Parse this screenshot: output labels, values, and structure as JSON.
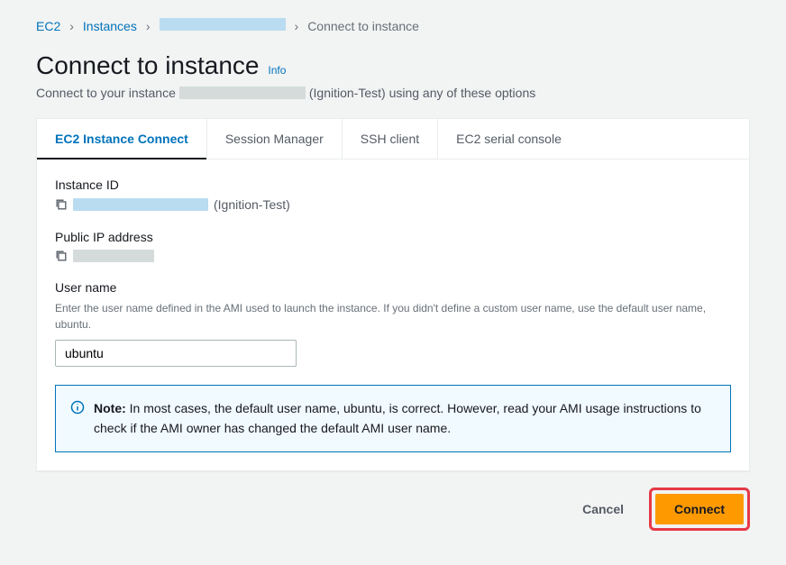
{
  "breadcrumb": {
    "root": "EC2",
    "instances": "Instances",
    "current": "Connect to instance"
  },
  "header": {
    "title": "Connect to instance",
    "info": "Info",
    "subtitle_prefix": "Connect to your instance",
    "subtitle_suffix": "(Ignition-Test) using any of these options"
  },
  "tabs": {
    "ec2_connect": "EC2 Instance Connect",
    "session_manager": "Session Manager",
    "ssh_client": "SSH client",
    "serial_console": "EC2 serial console"
  },
  "fields": {
    "instance_id_label": "Instance ID",
    "instance_id_suffix": "(Ignition-Test)",
    "public_ip_label": "Public IP address",
    "username_label": "User name",
    "username_help": "Enter the user name defined in the AMI used to launch the instance. If you didn't define a custom user name, use the default user name, ubuntu.",
    "username_value": "ubuntu"
  },
  "note": {
    "label": "Note:",
    "text": " In most cases, the default user name, ubuntu, is correct. However, read your AMI usage instructions to check if the AMI owner has changed the default AMI user name."
  },
  "buttons": {
    "cancel": "Cancel",
    "connect": "Connect"
  }
}
